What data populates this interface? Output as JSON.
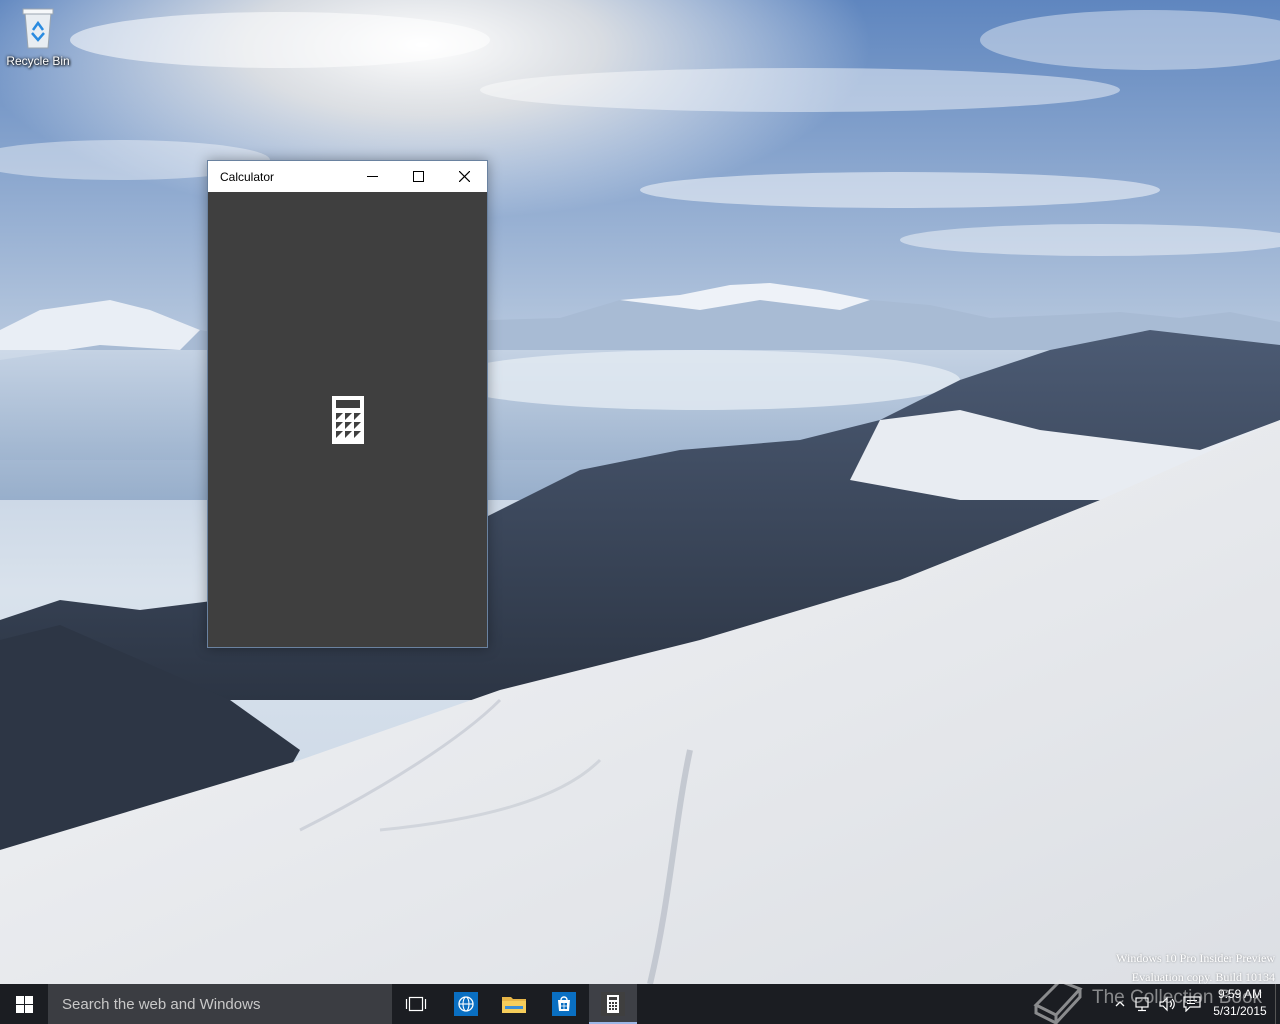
{
  "desktop": {
    "icons": [
      {
        "label": "Recycle Bin",
        "icon": "recycle-bin-icon"
      }
    ]
  },
  "window": {
    "title": "Calculator",
    "controls": {
      "minimize": "minimize-icon",
      "maximize": "maximize-icon",
      "close": "close-icon"
    },
    "background": "#3f3f3f",
    "splash_icon": "calculator-icon"
  },
  "watermark": {
    "line1": "Windows 10 Pro Insider Preview",
    "line2": "Evaluation copy. Build 10134"
  },
  "taskbar": {
    "search_placeholder": "Search the web and Windows",
    "pinned": [
      {
        "name": "task-view",
        "icon": "task-view-icon"
      },
      {
        "name": "browser",
        "icon": "globe-icon"
      },
      {
        "name": "file-explorer",
        "icon": "folder-icon"
      },
      {
        "name": "store",
        "icon": "store-icon"
      },
      {
        "name": "calculator",
        "icon": "calculator-icon",
        "active": true
      }
    ],
    "tray": {
      "icons": [
        "chevron-up-icon",
        "network-icon",
        "volume-icon",
        "action-center-icon"
      ],
      "time": "9:59 AM",
      "date": "5/31/2015"
    },
    "overlay_logo_text": "The Collection Book"
  },
  "colors": {
    "taskbar": "#1b1d22",
    "search_box": "#3b3d42",
    "accent": "#0a6fc2"
  }
}
